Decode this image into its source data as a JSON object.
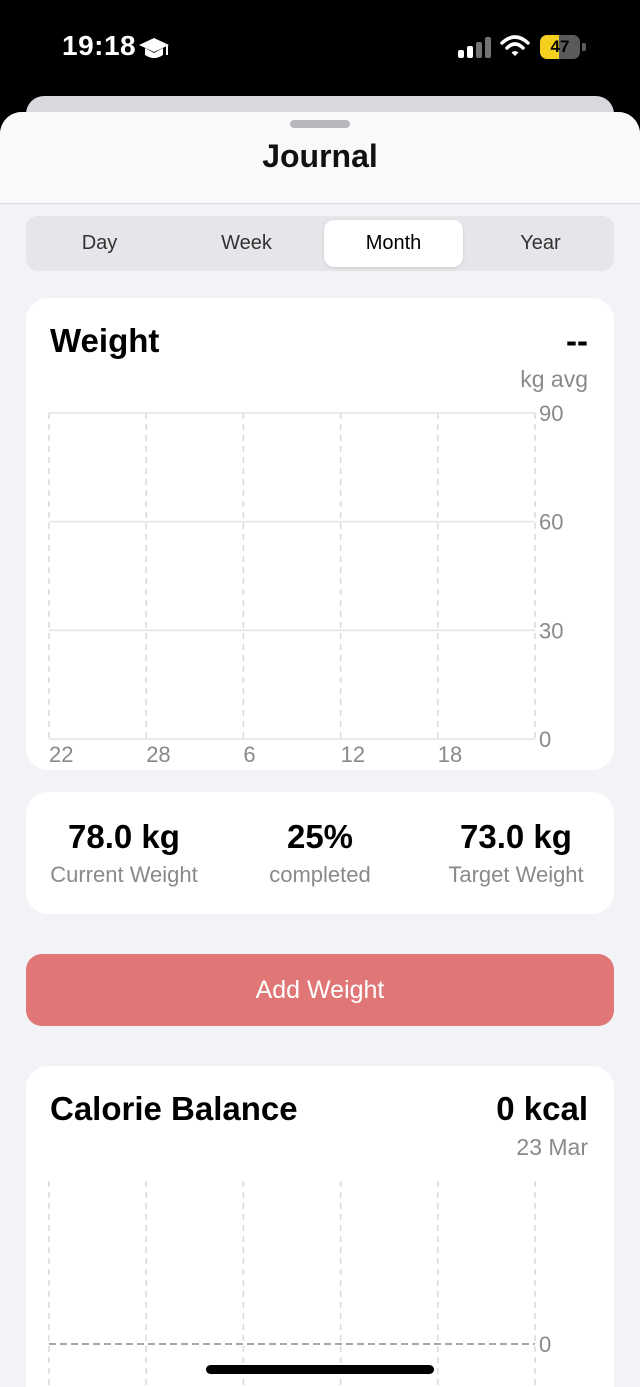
{
  "status_bar": {
    "time": "19:18",
    "battery_level": "47",
    "battery_fraction": 0.47,
    "battery_color": "#f5cf1e",
    "icons": [
      "graduation-cap-icon",
      "signal-icon",
      "wifi-icon",
      "battery-icon"
    ]
  },
  "sheet": {
    "title": "Journal"
  },
  "segmented": {
    "options": [
      "Day",
      "Week",
      "Month",
      "Year"
    ],
    "selected": "Month"
  },
  "weight_card": {
    "title": "Weight",
    "value": "--",
    "unit_label": "kg avg",
    "chart_data": {
      "type": "line",
      "x_ticks": [
        "22",
        "28",
        "6",
        "12",
        "18"
      ],
      "y_ticks": [
        "90",
        "60",
        "30",
        "0"
      ],
      "ylim": [
        0,
        90
      ],
      "series": [],
      "grid": true
    }
  },
  "stats": {
    "current": {
      "value": "78.0 kg",
      "label": "Current Weight"
    },
    "progress": {
      "value": "25%",
      "label": "completed"
    },
    "target": {
      "value": "73.0 kg",
      "label": "Target Weight"
    }
  },
  "add_button": {
    "label": "Add Weight",
    "color": "#e07676"
  },
  "calorie_card": {
    "title": "Calorie Balance",
    "value": "0 kcal",
    "date": "23 Mar",
    "chart_data": {
      "type": "bar",
      "y_ticks": [
        "0"
      ],
      "series": [],
      "grid": true
    }
  }
}
